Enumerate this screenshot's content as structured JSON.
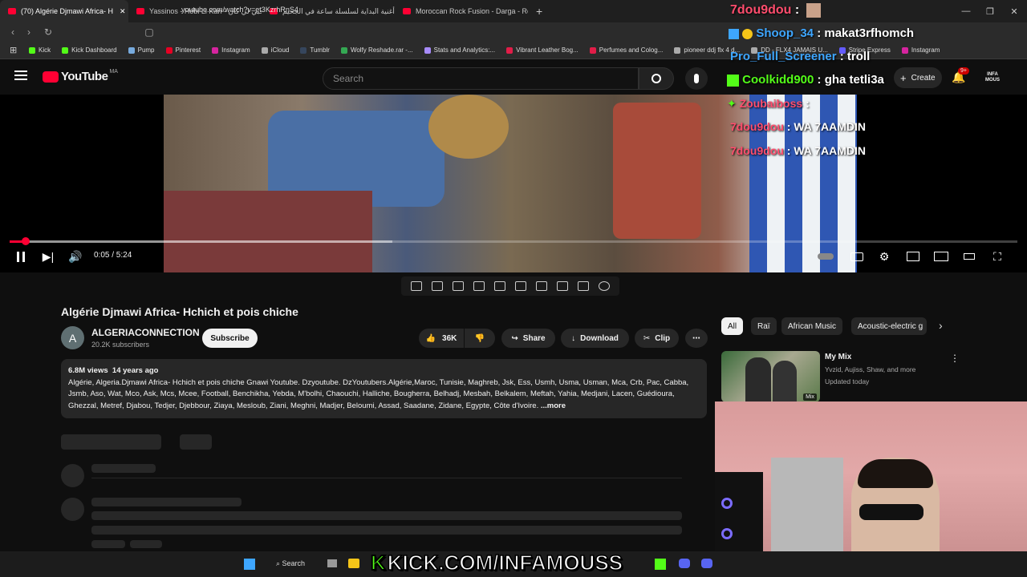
{
  "tabs": [
    {
      "label": "(70) Algérie Djmawi Africa- H"
    },
    {
      "label": "Yassinos - Hobi Li Kan - حبي لي كان"
    },
    {
      "label": "أغنية البداية لسلسلة ساعة في الجحيم -"
    },
    {
      "label": "Moroccan Rock Fusion - Darga - Resc"
    }
  ],
  "address": {
    "url": "youtube.com/watch?v=et3KzrhRnS4"
  },
  "bookmarks": [
    {
      "label": "Kick",
      "color": "#53fc18"
    },
    {
      "label": "Kick Dashboard",
      "color": "#53fc18"
    },
    {
      "label": "Pump",
      "color": "#7ad"
    },
    {
      "label": "Pinterest",
      "color": "#e60023"
    },
    {
      "label": "Instagram",
      "color": "#d6249f"
    },
    {
      "label": "iCloud",
      "color": "#aaa"
    },
    {
      "label": "Tumblr",
      "color": "#36465d"
    },
    {
      "label": "Wolfy Reshade.rar -...",
      "color": "#34a853"
    },
    {
      "label": "Stats and Analytics:...",
      "color": "#a78bfa"
    },
    {
      "label": "Vibrant Leather Bog...",
      "color": "#e11d48"
    },
    {
      "label": "Perfumes and Colog...",
      "color": "#e11d48"
    },
    {
      "label": "pioneer ddj flx 4 d...",
      "color": "#aaa"
    },
    {
      "label": "DD - FLX4 JAMAIS U...",
      "color": "#aaa"
    },
    {
      "label": "Stripe Express",
      "color": "#635bff"
    },
    {
      "label": "Instagram",
      "color": "#d6249f"
    }
  ],
  "header": {
    "logo": "YouTube",
    "region": "MA",
    "search_placeholder": "Search",
    "create": "Create",
    "notif_count": "9+",
    "account": "INFA MOUS"
  },
  "player": {
    "timecode": "0:05 / 5:24",
    "progress_fraction": 0.016,
    "buffered_fraction": 0.38
  },
  "video": {
    "title": "Algérie Djmawi Africa- Hchich et pois chiche",
    "channel": "ALGERIACONNECTION",
    "avatar_letter": "A",
    "subscribers": "20.2K subscribers",
    "subscribe": "Subscribe",
    "likes": "36K",
    "share": "Share",
    "download": "Download",
    "clip": "Clip",
    "views": "6.8M views",
    "age": "14 years ago",
    "description": "Algérie, Algeria.Djmawi Africa- Hchich et pois chiche Gnawi Youtube. Dzyoutube. DzYoutubers.Algérie,Maroc, Tunisie, Maghreb, Jsk, Ess, Usmh, Usma, Usman, Mca, Crb, Pac, Cabba, Jsmb, Aso, Wat, Mco, Ask, Mcs, Mcee, Football, Benchikha, Yebda, M'bolhi, Chaouchi, Halliche, Bougherra, Belhadj, Mesbah, Belkalem, Meftah, Yahia, Medjani, Lacen, Guédioura, Ghezzal, Metref, Djabou, Tedjer, Djebbour, Ziaya, Mesloub, Ziani, Meghni, Madjer, Beloumi, Assad, Saadane, Zidane, Egypte, Côte d'Ivoire.",
    "more": "...more"
  },
  "chips": [
    "All",
    "Raï",
    "African Music",
    "Acoustic-electric g"
  ],
  "mix": {
    "title": "My Mix",
    "artists": "Yvzid, Aujiss, Shaw, and more",
    "updated": "Updated today",
    "badge": "Mix"
  },
  "chat": [
    {
      "user": "7dou9dou",
      "msg": "",
      "color": "#ff4d6d"
    },
    {
      "user": "Shoop_34",
      "msg": "makat3rfhomch",
      "color": "#3ea6ff"
    },
    {
      "user": "Pro_Full_Screener",
      "msg": "troll",
      "color": "#3ea6ff"
    },
    {
      "user": "Coolkidd900",
      "msg": "gha tetli3a",
      "color": "#53fc18"
    },
    {
      "user": "Zoubaiboss",
      "msg": "",
      "color": "#ff4d6d"
    },
    {
      "user": "7dou9dou",
      "msg": "WA 7AAMDIN",
      "color": "#ff4d6d"
    },
    {
      "user": "7dou9dou",
      "msg": "WA 7AAMDIN",
      "color": "#ff4d6d"
    }
  ],
  "overlay": {
    "kick_banner": "KICK.COM/INFAMOUSS"
  },
  "taskbar": {
    "search": "Search"
  }
}
